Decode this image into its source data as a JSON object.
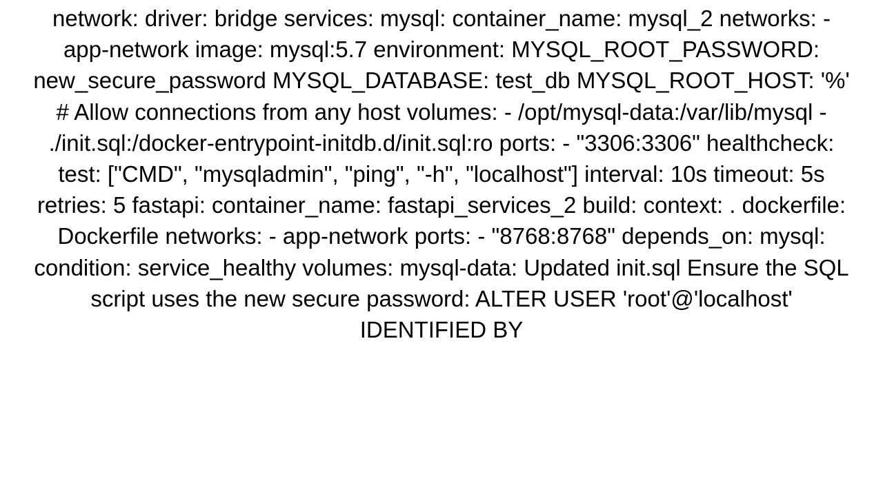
{
  "text": "network:     driver: bridge  services:   mysql:     container_name: mysql_2     networks:       - app-network     image: mysql:5.7     environment:       MYSQL_ROOT_PASSWORD: new_secure_password       MYSQL_DATABASE: test_db       MYSQL_ROOT_HOST: '%'  # Allow connections from any host     volumes:       - /opt/mysql-data:/var/lib/mysql       - ./init.sql:/docker-entrypoint-initdb.d/init.sql:ro     ports:       - \"3306:3306\"     healthcheck:       test: [\"CMD\", \"mysqladmin\", \"ping\", \"-h\", \"localhost\"]       interval: 10s       timeout: 5s       retries: 5    fastapi:     container_name: fastapi_services_2     build:       context: .       dockerfile: Dockerfile     networks:       - app-network     ports:       - \"8768:8768\"     depends_on:       mysql:         condition: service_healthy  volumes:   mysql-data:  Updated init.sql Ensure the SQL script uses the new secure password: ALTER USER 'root'@'localhost' IDENTIFIED BY"
}
